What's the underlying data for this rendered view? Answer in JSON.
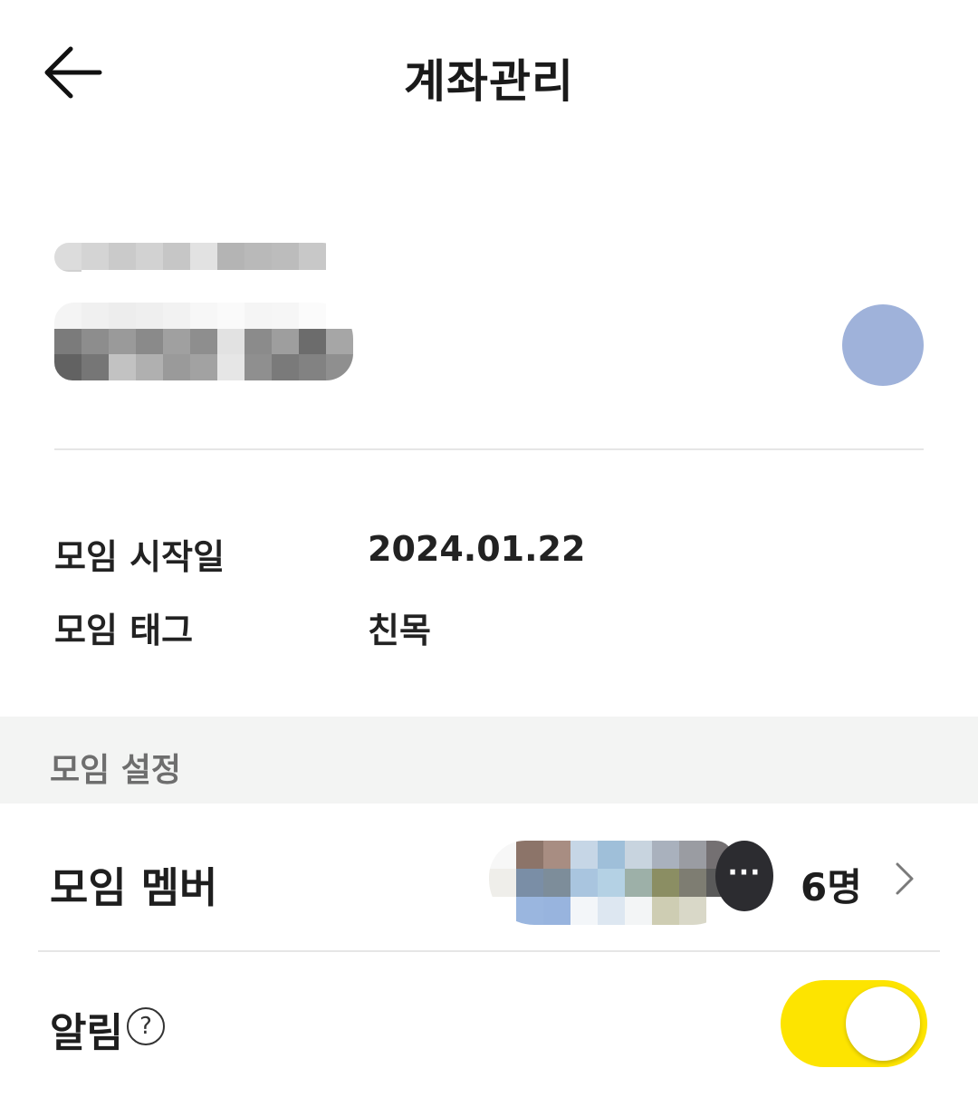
{
  "header": {
    "title": "계좌관리",
    "back_icon": "arrow-left-icon"
  },
  "account": {
    "avatar_color": "#9fb2da"
  },
  "info": {
    "rows": [
      {
        "label": "모임 시작일",
        "value": "2024.01.22"
      },
      {
        "label": "모임 태그",
        "value": "친목"
      }
    ]
  },
  "settings": {
    "section_title": "모임 설정",
    "members": {
      "label": "모임 멤버",
      "more_indicator": "···",
      "count": "6명",
      "chevron_icon": "chevron-right-icon"
    },
    "notification": {
      "label": "알림",
      "help_icon": "question-circle-icon",
      "help_glyph": "?",
      "enabled": true,
      "toggle_color": "#fde400"
    }
  }
}
